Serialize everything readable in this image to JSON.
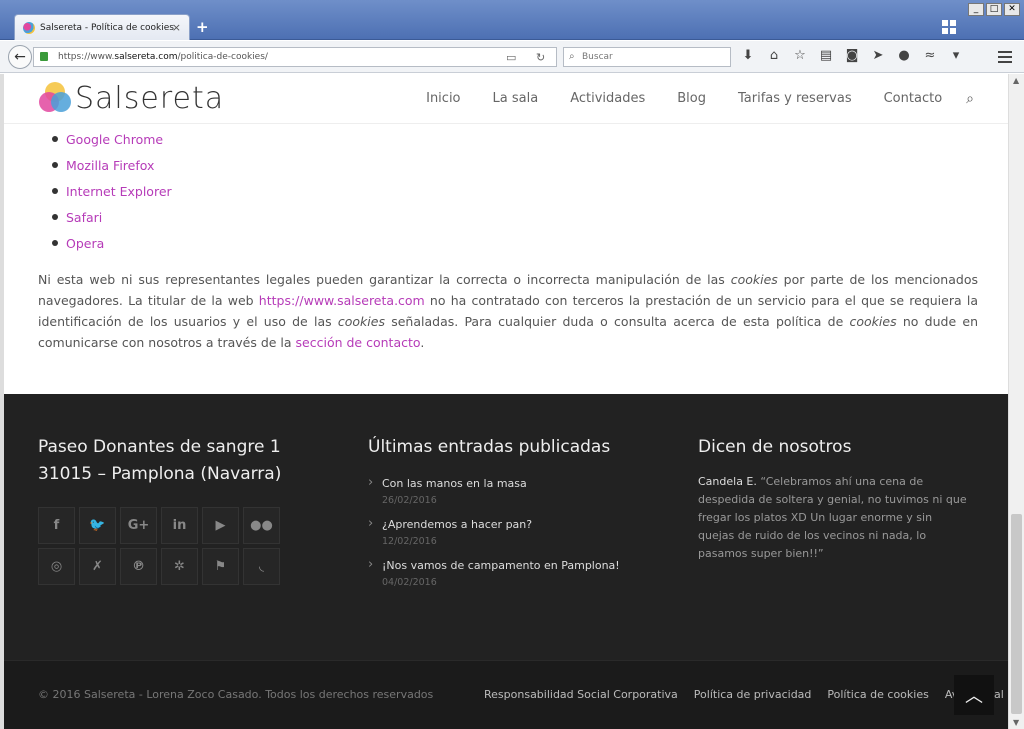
{
  "browser": {
    "tab_title": "Salsereta - Política de cookies",
    "new_tab": "+",
    "url_prefix": "https://www.",
    "url_host": "salsereta.com",
    "url_path": "/politica-de-cookies/",
    "search_placeholder": "Buscar",
    "window_buttons": [
      "_",
      "□",
      "✕"
    ],
    "tab_close": "×"
  },
  "site": {
    "logo_text": "Salsereta",
    "nav": [
      "Inicio",
      "La sala",
      "Actividades",
      "Blog",
      "Tarifas y reservas",
      "Contacto"
    ]
  },
  "browsers_list": [
    "Google Chrome",
    "Mozilla Firefox",
    "Internet Explorer",
    "Safari",
    "Opera"
  ],
  "paragraph": {
    "p1": "Ni esta web ni sus representantes legales pueden garantizar la correcta o incorrecta manipulación de las ",
    "cookies1": "cookies",
    "p2": " por parte de los mencionados navegadores. La titular de la web ",
    "link": "https://www.salsereta.com",
    "p3": " no ha contratado con terceros la prestación de un servicio para el que se requiera la identificación de los usuarios y el uso de las ",
    "cookies2": "cookies",
    "p4": " señaladas. Para cualquier duda o consulta acerca de esta política de ",
    "cookies3": "cookies",
    "p5": " no dude en comunicarse con nosotros a través de la ",
    "contact_link": "sección de contacto",
    "p6": "."
  },
  "footer": {
    "address_line1": "Paseo Donantes de sangre 1",
    "address_line2": "31015 – Pamplona (Navarra)",
    "social_icons": [
      "f",
      "🐦",
      "G+",
      "in",
      "▶",
      "●●",
      "◎",
      "✗",
      "℗",
      "✲",
      "⚑",
      "◟"
    ],
    "posts_title": "Últimas entradas publicadas",
    "posts": [
      {
        "title": "Con las manos en la masa",
        "date": "26/02/2016"
      },
      {
        "title": "¿Aprendemos a hacer pan?",
        "date": "12/02/2016"
      },
      {
        "title": "¡Nos vamos de campamento en Pamplona!",
        "date": "04/02/2016"
      }
    ],
    "testimonials_title": "Dicen de nosotros",
    "testimonial_author": "Candela E.",
    "testimonial_text": " “Celebramos ahí una cena de despedida de soltera y genial, no tuvimos ni que fregar los platos XD Un lugar enorme y sin quejas de ruido de los vecinos ni nada, lo pasamos super bien!!”"
  },
  "bottom": {
    "copyright": "© 2016 Salsereta - Lorena Zoco Casado. Todos los derechos reservados",
    "links": [
      "Responsabilidad Social Corporativa",
      "Política de privacidad",
      "Política de cookies",
      "Aviso legal"
    ]
  }
}
